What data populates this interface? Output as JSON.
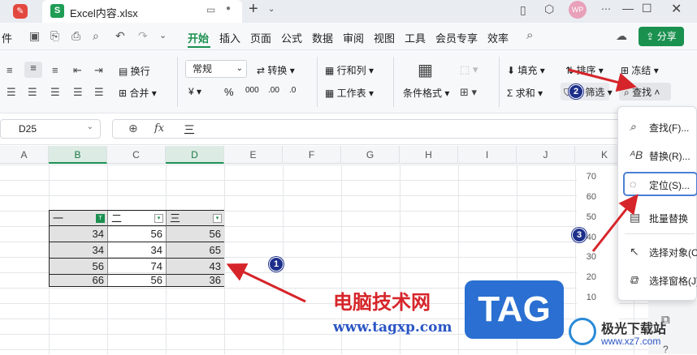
{
  "window": {
    "file_tab": "Excel内容.xlsx",
    "avatar": "WP"
  },
  "menu": {
    "file_partial": "件",
    "items": [
      "开始",
      "插入",
      "页面",
      "公式",
      "数据",
      "审阅",
      "视图",
      "工具",
      "会员专享",
      "效率"
    ],
    "share": "分享"
  },
  "ribbon": {
    "wrap": "换行",
    "merge": "合并",
    "format": "常规",
    "convert": "转换",
    "rowcol": "行和列",
    "sheet": "工作表",
    "cond_format": "条件格式",
    "fill": "填充",
    "sort": "排序",
    "freeze": "冻结",
    "sum": "求和",
    "filter": "筛选",
    "find": "查找"
  },
  "formula_bar": {
    "cell_ref": "D25",
    "fx": "fx",
    "content": "三"
  },
  "columns": [
    "A",
    "B",
    "C",
    "D",
    "E",
    "F",
    "G",
    "H",
    "I",
    "J",
    "K"
  ],
  "table": {
    "headers": [
      "一",
      "二",
      "三"
    ],
    "rows": [
      [
        "34",
        "56",
        "56"
      ],
      [
        "34",
        "34",
        "65"
      ],
      [
        "56",
        "74",
        "43"
      ],
      [
        "66",
        "56",
        "36"
      ]
    ]
  },
  "chart_axis": [
    "70",
    "60",
    "50",
    "40",
    "30",
    "20",
    "10"
  ],
  "dropdown": {
    "items": [
      "查找(F)...",
      "替换(R)...",
      "定位(S)...",
      "批量替换",
      "选择对象(C",
      "选择窗格(J)"
    ]
  },
  "watermark": {
    "site_name": "电脑技术网",
    "tag": "TAG",
    "url": "www.tagxp.com",
    "brand": "极光下载站",
    "brand_url": "www.xz7.com"
  },
  "markers": [
    "1",
    "2",
    "3"
  ],
  "colors": {
    "accent": "#1b9150",
    "arrow": "#d6252a",
    "marker": "#1d2f8a"
  }
}
